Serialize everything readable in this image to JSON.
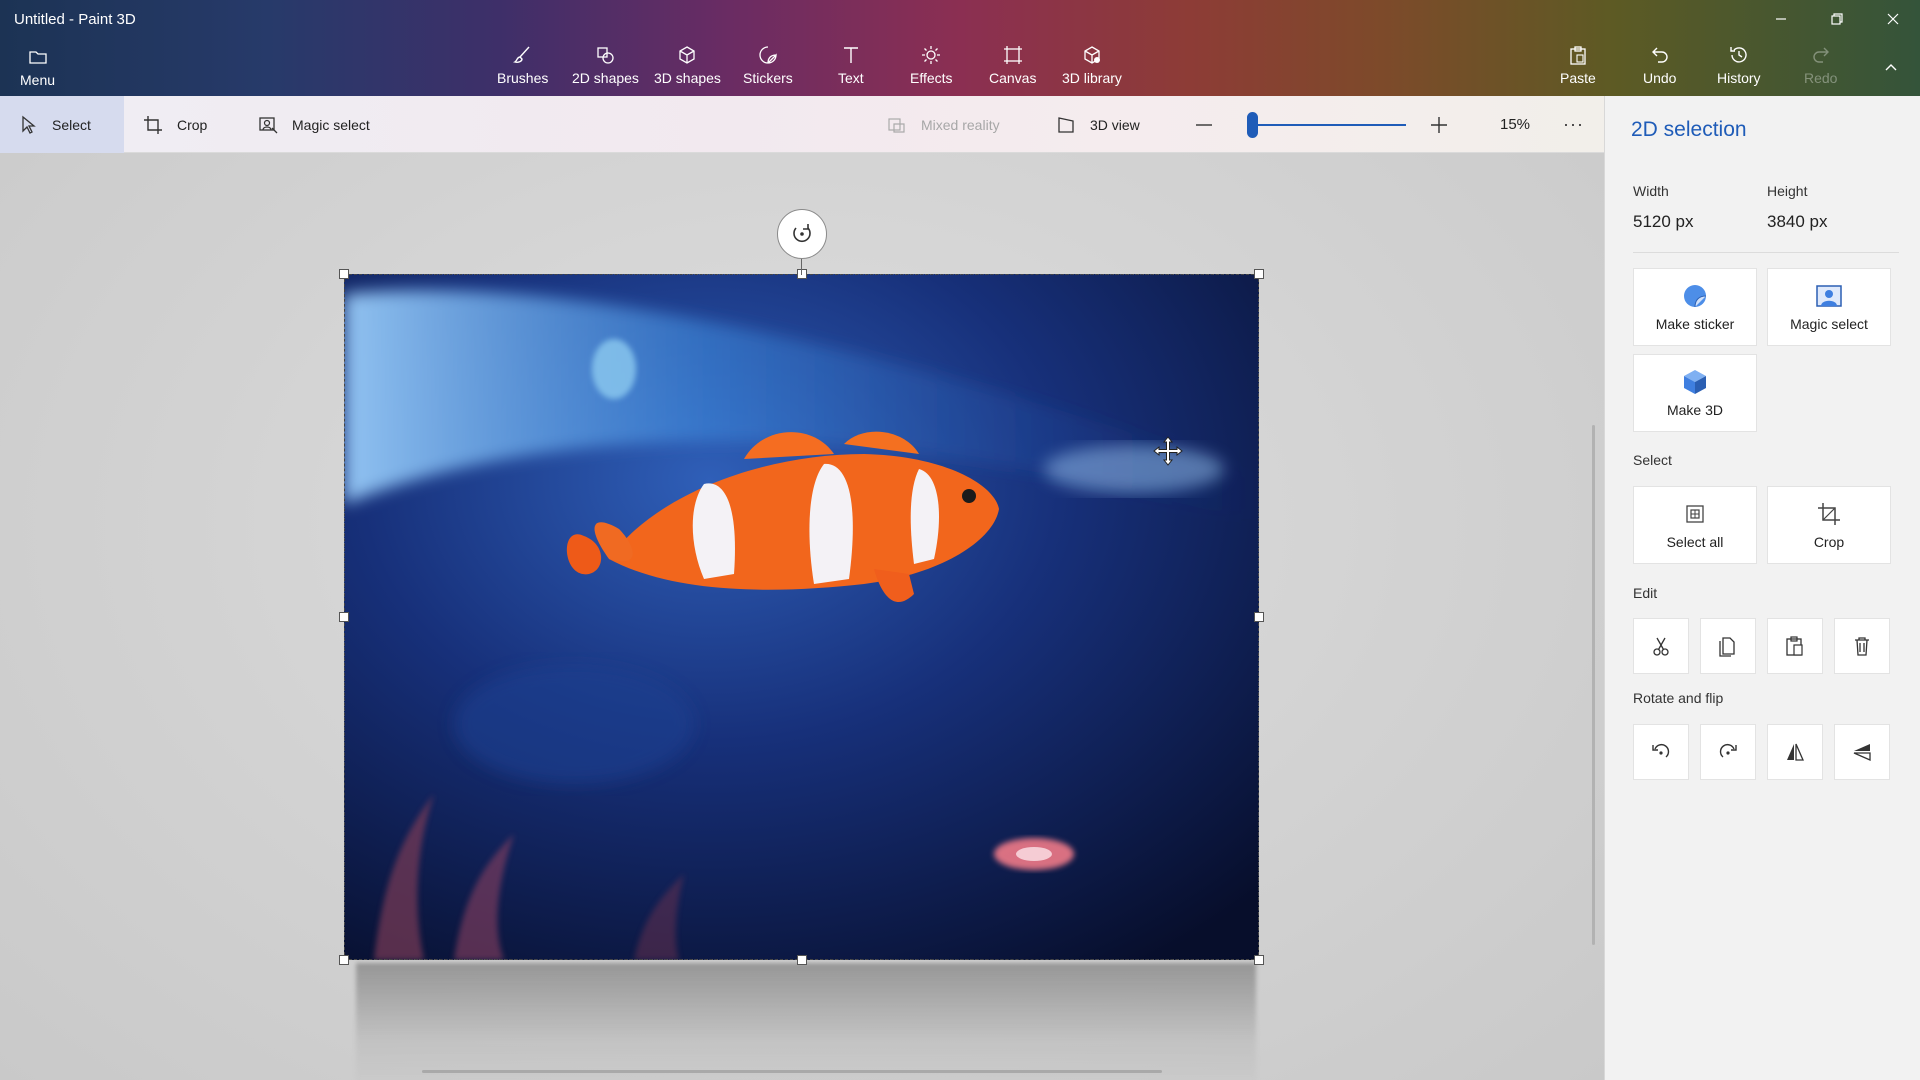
{
  "window": {
    "title": "Untitled - Paint 3D"
  },
  "ribbon": {
    "menu": "Menu",
    "tools": [
      {
        "label": "Brushes"
      },
      {
        "label": "2D shapes"
      },
      {
        "label": "3D shapes"
      },
      {
        "label": "Stickers"
      },
      {
        "label": "Text"
      },
      {
        "label": "Effects"
      },
      {
        "label": "Canvas"
      },
      {
        "label": "3D library"
      }
    ],
    "actions": [
      {
        "label": "Paste"
      },
      {
        "label": "Undo"
      },
      {
        "label": "History"
      },
      {
        "label": "Redo"
      }
    ]
  },
  "toolbar": {
    "select": "Select",
    "crop": "Crop",
    "magic_select": "Magic select",
    "mixed_reality": "Mixed reality",
    "view_3d": "3D view",
    "zoom": "15%",
    "zoom_fraction": 0.03,
    "more": "···"
  },
  "panel": {
    "title": "2D selection",
    "width_label": "Width",
    "width_value": "5120 px",
    "height_label": "Height",
    "height_value": "3840 px",
    "make_sticker": "Make sticker",
    "magic_select": "Magic select",
    "make_3d": "Make 3D",
    "select_section": "Select",
    "select_all": "Select all",
    "crop": "Crop",
    "edit_section": "Edit",
    "rotate_section": "Rotate and flip"
  },
  "colors": {
    "accent": "#1f5cb8",
    "select_highlight": "#d6dbee"
  },
  "icons": {
    "edit": [
      "cut-icon",
      "copy-icon",
      "paste-icon",
      "delete-icon"
    ],
    "rotate": [
      "rotate-left-icon",
      "rotate-right-icon",
      "flip-vertical-icon",
      "flip-horizontal-icon"
    ]
  }
}
